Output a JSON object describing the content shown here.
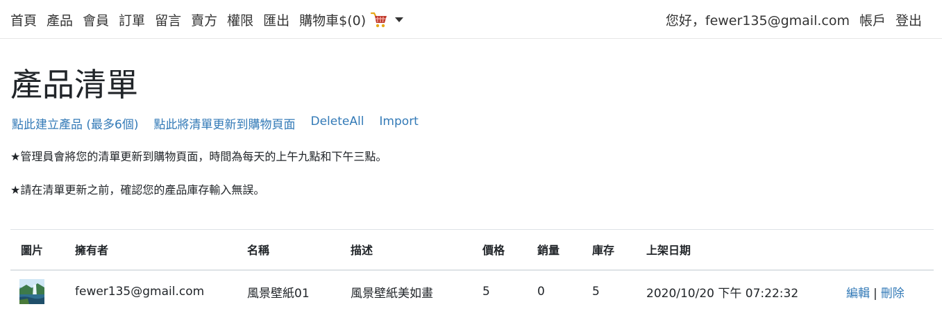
{
  "nav": {
    "items": [
      "首頁",
      "產品",
      "會員",
      "訂單",
      "留言",
      "賣方",
      "權限",
      "匯出"
    ],
    "cart_label": "購物車$(0)",
    "greeting": "您好，fewer135@gmail.com",
    "account": "帳戶",
    "logout": "登出"
  },
  "page": {
    "title": "產品清單",
    "actions": [
      "點此建立產品 (最多6個)",
      "點此將清單更新到購物頁面",
      "DeleteAll",
      "Import"
    ],
    "note1": "★管理員會將您的清單更新到購物頁面，時間為每天的上午九點和下午三點。",
    "note2": "★請在清單更新之前，確認您的產品庫存輸入無誤。"
  },
  "table": {
    "headers": [
      "圖片",
      "擁有者",
      "名稱",
      "描述",
      "價格",
      "銷量",
      "庫存",
      "上架日期"
    ],
    "rows": [
      {
        "owner": "fewer135@gmail.com",
        "name": "風景壁紙01",
        "description": "風景壁紙美如畫",
        "price": "5",
        "sales": "0",
        "stock": "5",
        "date": "2020/10/20 下午 07:22:32",
        "edit": "編輯",
        "sep": "|",
        "delete": "刪除"
      }
    ]
  },
  "colors": {
    "link": "#337ab7",
    "text": "#212529",
    "cart_basket": "#c0392b",
    "cart_handle": "#e6a817"
  },
  "icons": {
    "cart": "shopping-cart-icon",
    "caret": "caret-down-icon",
    "thumbnail": "landscape-thumbnail"
  }
}
